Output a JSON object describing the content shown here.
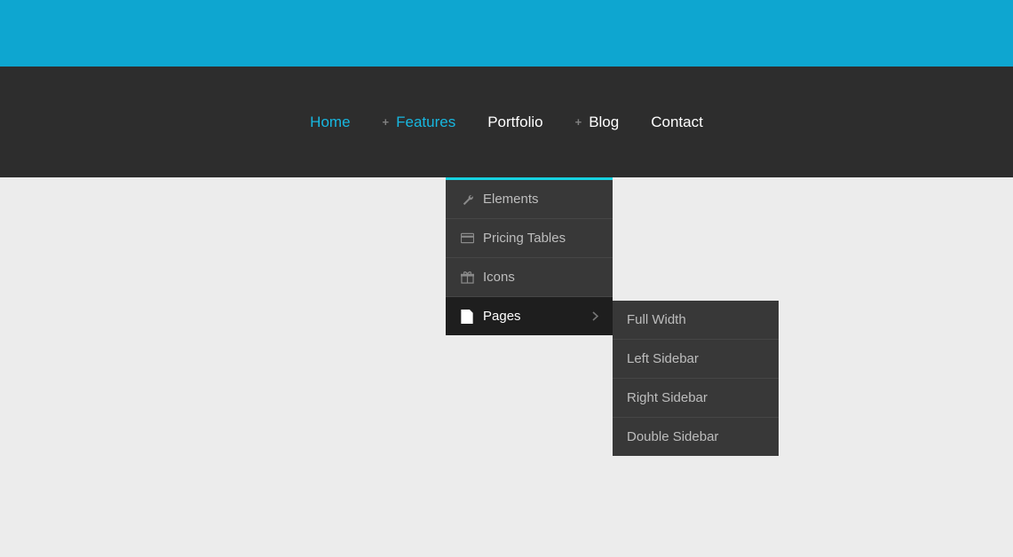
{
  "colors": {
    "accent": "#17b7e0",
    "topbar": "#0ea6d0",
    "navbg": "#2d2d2d",
    "dropbg": "#383838",
    "page": "#ececec"
  },
  "nav": {
    "items": [
      {
        "label": "Home",
        "active": true,
        "hasSub": false
      },
      {
        "label": "Features",
        "active": false,
        "hasSub": true,
        "open": true
      },
      {
        "label": "Portfolio",
        "active": false,
        "hasSub": false
      },
      {
        "label": "Blog",
        "active": false,
        "hasSub": true
      },
      {
        "label": "Contact",
        "active": false,
        "hasSub": false
      }
    ]
  },
  "featuresMenu": {
    "items": [
      {
        "icon": "wrench-icon",
        "label": "Elements"
      },
      {
        "icon": "card-icon",
        "label": "Pricing Tables"
      },
      {
        "icon": "gift-icon",
        "label": "Icons"
      },
      {
        "icon": "document-icon",
        "label": "Pages",
        "active": true,
        "hasSub": true
      }
    ]
  },
  "pagesSubmenu": {
    "items": [
      {
        "label": "Full Width"
      },
      {
        "label": "Left Sidebar"
      },
      {
        "label": "Right Sidebar"
      },
      {
        "label": "Double Sidebar"
      }
    ]
  }
}
